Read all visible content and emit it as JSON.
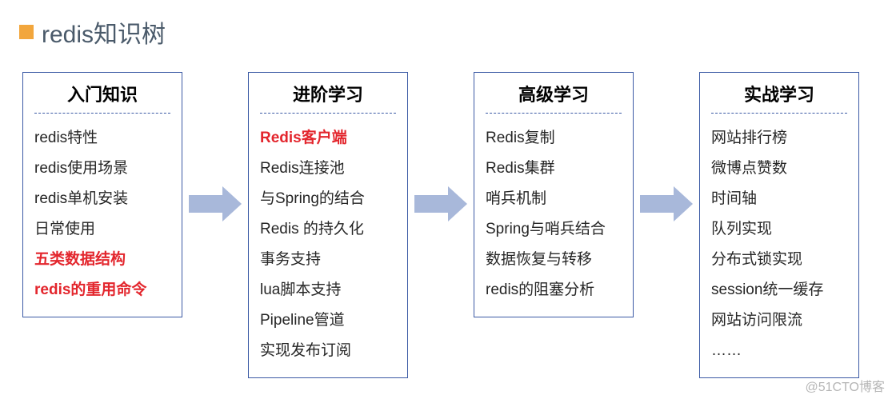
{
  "title": "redis知识树",
  "watermark": "@51CTO博客",
  "columns": [
    {
      "heading": "入门知识",
      "items": [
        {
          "text": "redis特性",
          "em": false
        },
        {
          "text": "redis使用场景",
          "em": false
        },
        {
          "text": "redis单机安装",
          "em": false
        },
        {
          "text": "日常使用",
          "em": false
        },
        {
          "text": "五类数据结构",
          "em": true
        },
        {
          "text": "redis的重用命令",
          "em": true
        }
      ]
    },
    {
      "heading": "进阶学习",
      "items": [
        {
          "text": "Redis客户端",
          "em": true
        },
        {
          "text": "Redis连接池",
          "em": false
        },
        {
          "text": "与Spring的结合",
          "em": false
        },
        {
          "text": "Redis 的持久化",
          "em": false
        },
        {
          "text": "事务支持",
          "em": false
        },
        {
          "text": "lua脚本支持",
          "em": false
        },
        {
          "text": "Pipeline管道",
          "em": false
        },
        {
          "text": "实现发布订阅",
          "em": false
        }
      ]
    },
    {
      "heading": "高级学习",
      "items": [
        {
          "text": "Redis复制",
          "em": false
        },
        {
          "text": "Redis集群",
          "em": false
        },
        {
          "text": "哨兵机制",
          "em": false
        },
        {
          "text": "Spring与哨兵结合",
          "em": false
        },
        {
          "text": "数据恢复与转移",
          "em": false
        },
        {
          "text": "redis的阻塞分析",
          "em": false
        }
      ]
    },
    {
      "heading": "实战学习",
      "items": [
        {
          "text": "网站排行榜",
          "em": false
        },
        {
          "text": "微博点赞数",
          "em": false
        },
        {
          "text": "时间轴",
          "em": false
        },
        {
          "text": "队列实现",
          "em": false
        },
        {
          "text": "分布式锁实现",
          "em": false
        },
        {
          "text": "session统一缓存",
          "em": false
        },
        {
          "text": "网站访问限流",
          "em": false
        },
        {
          "text": "……",
          "em": false
        }
      ]
    }
  ]
}
